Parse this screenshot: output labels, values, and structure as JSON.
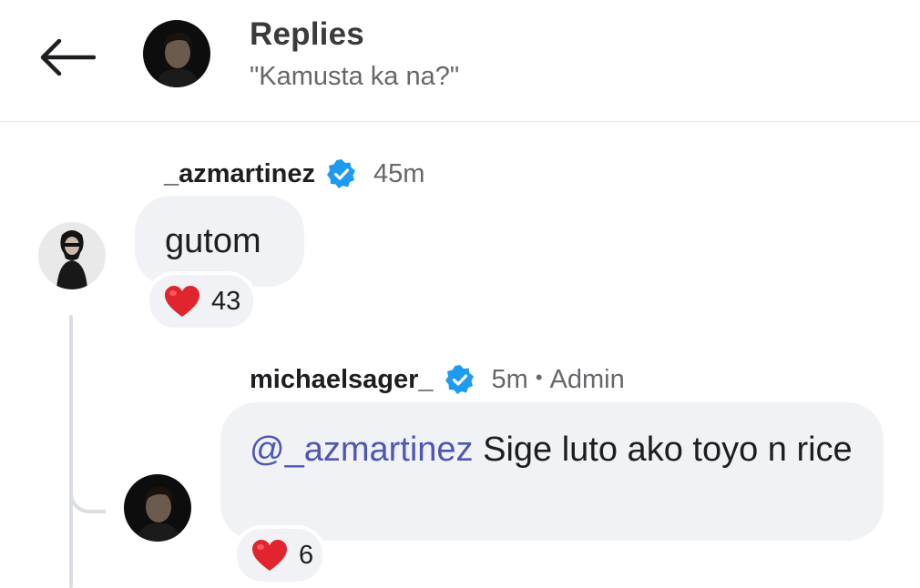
{
  "header": {
    "title": "Replies",
    "subtitle": "\"Kamusta ka na?\""
  },
  "comments": [
    {
      "username": "_azmartinez",
      "verified": true,
      "time": "45m",
      "text": "gutom",
      "reaction_count": "43"
    },
    {
      "username": "michaelsager_",
      "verified": true,
      "time": "5m",
      "separator": "•",
      "role": "Admin",
      "mention": "@_azmartinez",
      "text": " Sige luto ako toyo n rice",
      "reaction_count": "6"
    }
  ],
  "colors": {
    "verified": "#1d9bf0",
    "mention": "#4f56b3",
    "bubble": "#f0f2f5",
    "heart": "#e0252f"
  },
  "icons": {
    "back": "arrow-left-icon",
    "verified": "verified-badge-icon",
    "reaction": "heart-icon"
  }
}
